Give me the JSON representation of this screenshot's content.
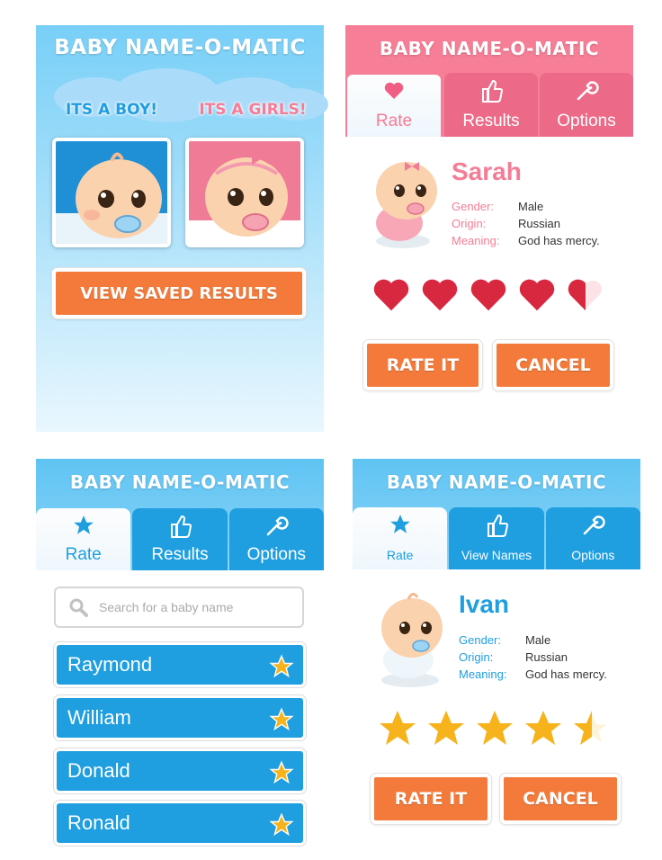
{
  "app_title": "BABY NAME-O-MATIC",
  "home": {
    "boy_label": "ITS A BOY!",
    "girl_label": "ITS A GIRLS!",
    "view_saved": "VIEW SAVED RESULTS"
  },
  "girl_screen": {
    "tabs": [
      {
        "label": "Rate",
        "icon": "heart-icon"
      },
      {
        "label": "Results",
        "icon": "thumbs-up-icon"
      },
      {
        "label": "Options",
        "icon": "wrench-icon"
      }
    ],
    "name": "Sarah",
    "gender_key": "Gender:",
    "gender": "Male",
    "origin_key": "Origin:",
    "origin": "Russian",
    "meaning_key": "Meaning:",
    "meaning": "God has mercy.",
    "rating": 4.5,
    "rate_button": "RATE IT",
    "cancel_button": "CANCEL"
  },
  "search_screen": {
    "tabs": [
      {
        "label": "Rate",
        "icon": "star-icon"
      },
      {
        "label": "Results",
        "icon": "thumbs-up-icon"
      },
      {
        "label": "Options",
        "icon": "wrench-icon"
      }
    ],
    "search_placeholder": "Search for a baby name",
    "names": [
      "Raymond",
      "William",
      "Donald",
      "Ronald"
    ]
  },
  "boy_screen": {
    "tabs": [
      {
        "label": "Rate",
        "icon": "star-icon"
      },
      {
        "label": "View Names",
        "icon": "thumbs-up-icon"
      },
      {
        "label": "Options",
        "icon": "wrench-icon"
      }
    ],
    "name": "Ivan",
    "gender_key": "Gender:",
    "gender": "Male",
    "origin_key": "Origin:",
    "origin": "Russian",
    "meaning_key": "Meaning:",
    "meaning": "God has mercy.",
    "rating": 4.5,
    "rate_button": "RATE IT",
    "cancel_button": "CANCEL"
  },
  "colors": {
    "blue": "#1f9ee0",
    "pink": "#f57c95",
    "orange": "#f37a3a",
    "sky": "#78cff7"
  }
}
